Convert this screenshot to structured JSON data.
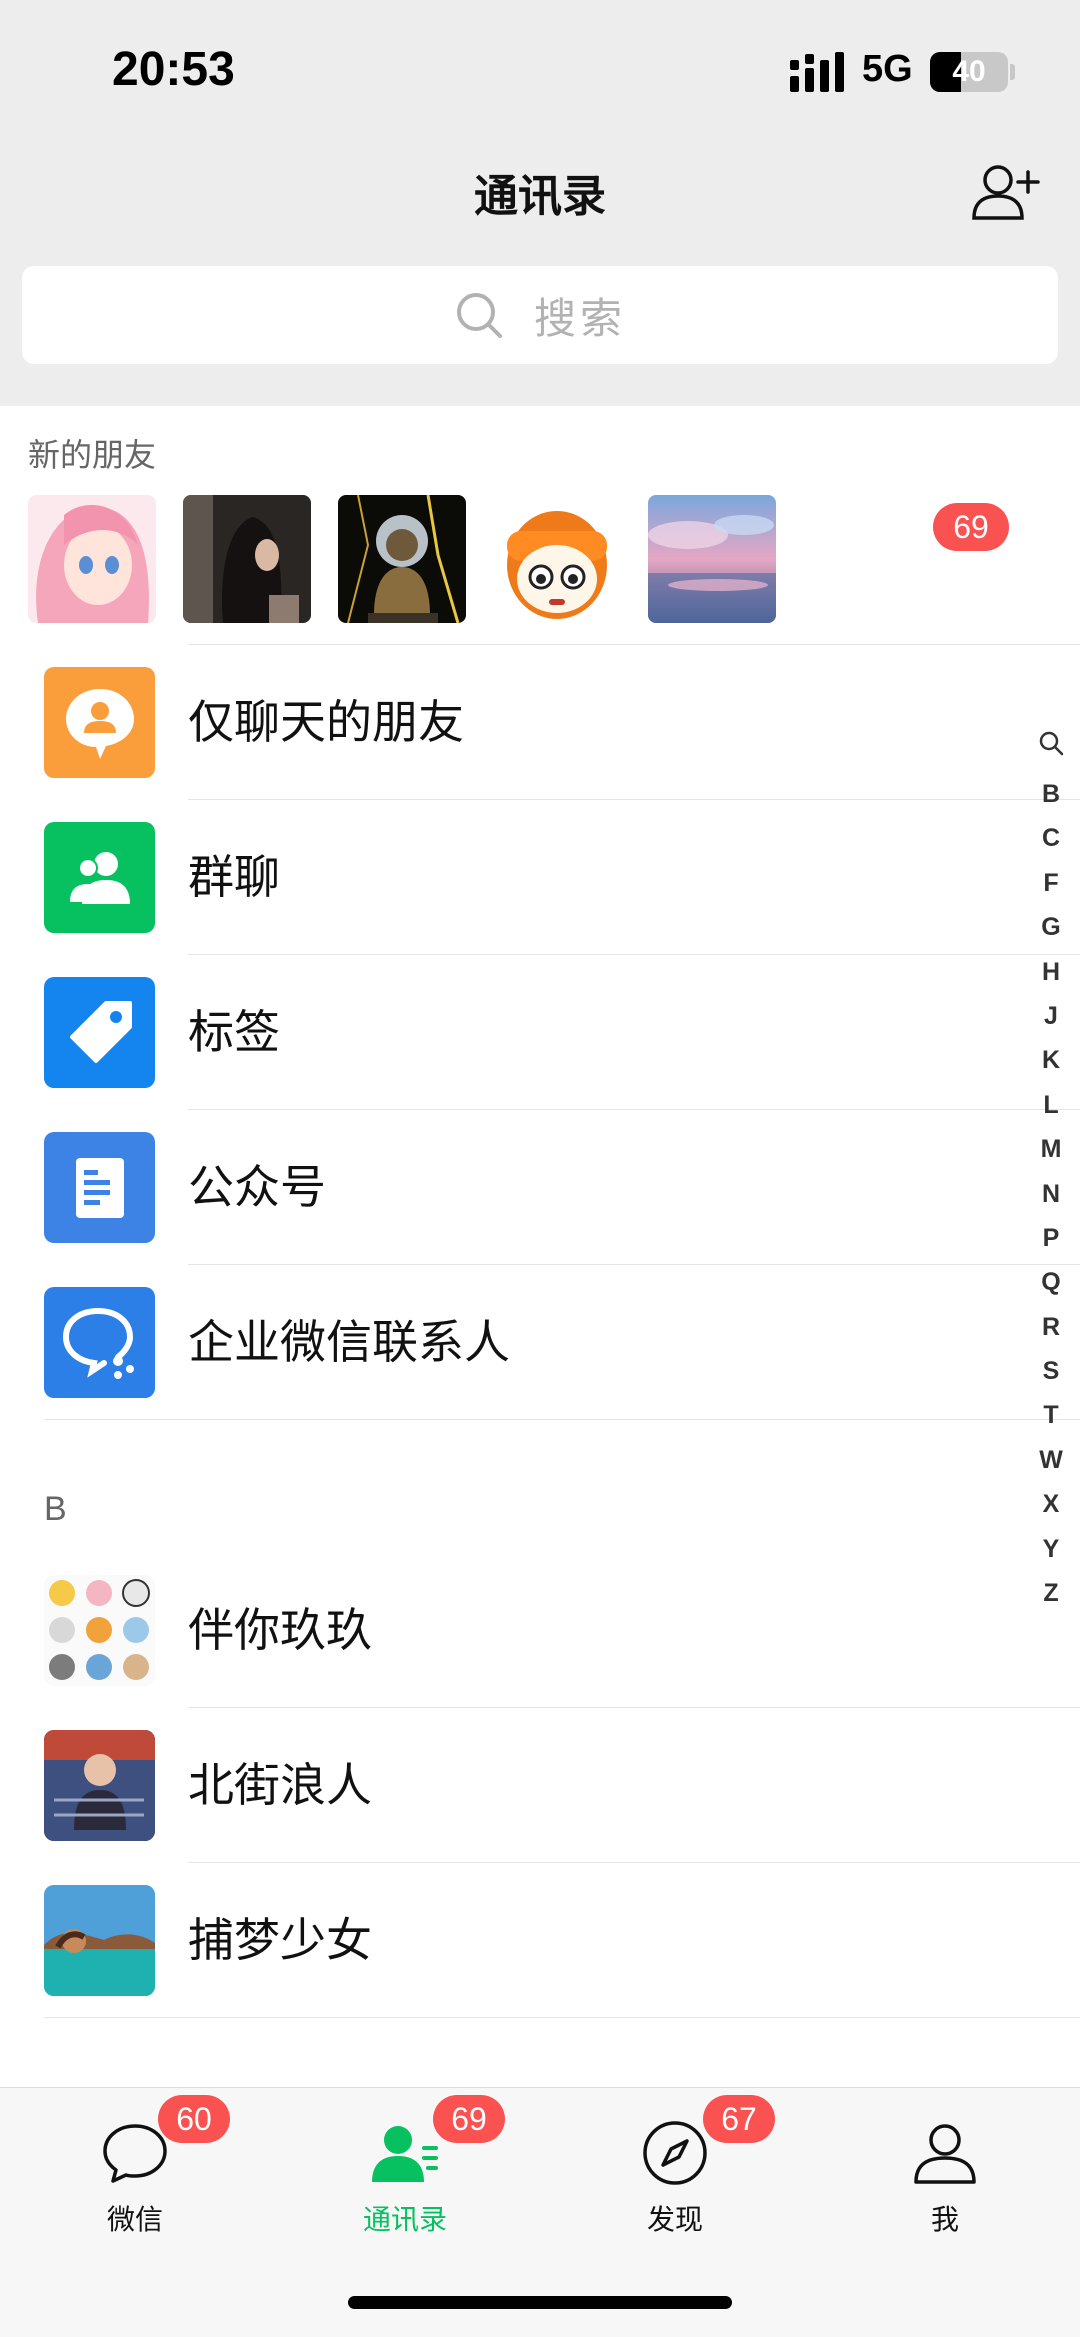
{
  "status": {
    "time": "20:53",
    "network": "5G",
    "battery": "40",
    "battery_level": 0.4
  },
  "header": {
    "title": "通讯录",
    "add_friend_icon": "add-friend-icon"
  },
  "search": {
    "placeholder": "搜索"
  },
  "new_friends": {
    "label": "新的朋友",
    "badge": "69"
  },
  "functions": [
    {
      "label": "仅聊天的朋友",
      "color": "#fa9d3b",
      "icon": "chat-only-friends-icon"
    },
    {
      "label": "群聊",
      "color": "#07c160",
      "icon": "group-chat-icon"
    },
    {
      "label": "标签",
      "color": "#1485ee",
      "icon": "tag-icon"
    },
    {
      "label": "公众号",
      "color": "#3d83e6",
      "icon": "official-account-icon"
    },
    {
      "label": "企业微信联系人",
      "color": "#2b7fe6",
      "icon": "wecom-contacts-icon"
    }
  ],
  "section_b": {
    "letter": "B"
  },
  "contacts": [
    {
      "name": "伴你玖玖"
    },
    {
      "name": "北街浪人"
    },
    {
      "name": "捕梦少女"
    }
  ],
  "alphabet": [
    "B",
    "C",
    "F",
    "G",
    "H",
    "J",
    "K",
    "L",
    "M",
    "N",
    "P",
    "Q",
    "R",
    "S",
    "T",
    "W",
    "X",
    "Y",
    "Z"
  ],
  "tabs": [
    {
      "label": "微信",
      "badge": "60",
      "icon": "chat-bubble-icon"
    },
    {
      "label": "通讯录",
      "badge": "69",
      "icon": "contacts-icon",
      "active": true
    },
    {
      "label": "发现",
      "badge": "67",
      "icon": "compass-icon"
    },
    {
      "label": "我",
      "icon": "person-icon"
    }
  ],
  "colors": {
    "accent": "#07c160",
    "badge": "#fa5151",
    "background": "#ededed"
  }
}
